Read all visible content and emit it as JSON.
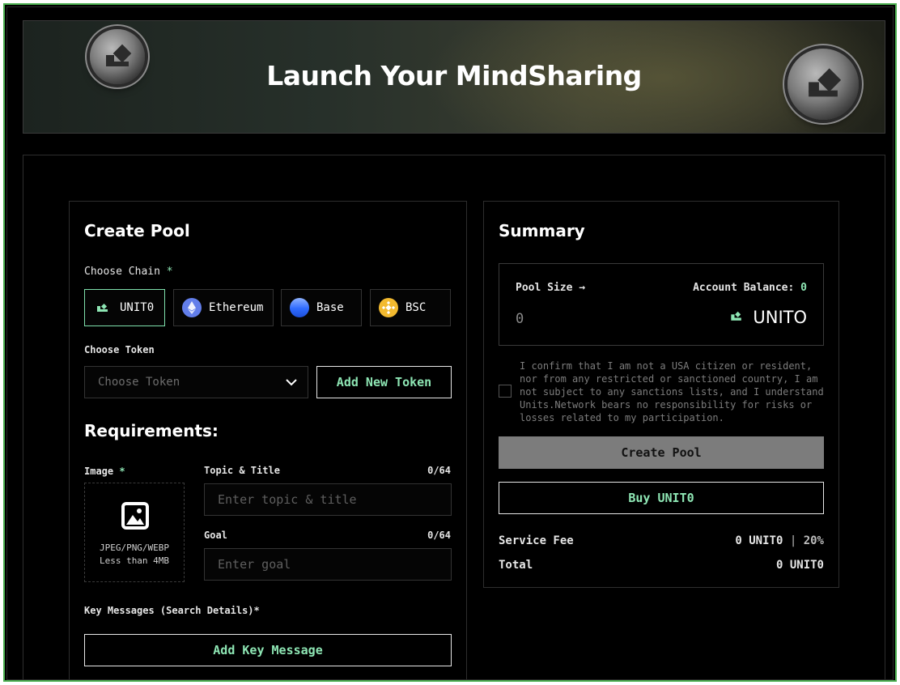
{
  "banner": {
    "title": "Launch Your MindSharing"
  },
  "create_pool": {
    "title": "Create Pool",
    "choose_chain_label": "Choose Chain",
    "required_mark": "*",
    "chains": [
      {
        "label": "UNIT0",
        "icon": "unit0-icon",
        "selected": true
      },
      {
        "label": "Ethereum",
        "icon": "ethereum-icon",
        "selected": false
      },
      {
        "label": "Base",
        "icon": "base-icon",
        "selected": false
      },
      {
        "label": "BSC",
        "icon": "bsc-icon",
        "selected": false
      }
    ],
    "choose_token_label": "Choose Token",
    "token_select_placeholder": "Choose Token",
    "add_new_token_label": "Add New Token",
    "requirements_title": "Requirements:",
    "image_label": "Image",
    "image_hint_formats": "JPEG/PNG/WEBP",
    "image_hint_size": "Less than 4MB",
    "topic_label": "Topic & Title",
    "topic_counter": "0/64",
    "topic_placeholder": "Enter topic & title",
    "goal_label": "Goal",
    "goal_counter": "0/64",
    "goal_placeholder": "Enter goal",
    "key_messages_label": "Key Messages (Search Details)*",
    "add_key_message_label": "Add Key Message"
  },
  "summary": {
    "title": "Summary",
    "pool_size_label": "Pool Size →",
    "account_balance_label": "Account Balance:",
    "account_balance_value": "0",
    "pool_size_value": "0",
    "token_name": "UNITO",
    "disclaimer": "I confirm that I am not a USA citizen or resident, nor from any restricted or sanctioned country, I am not subject to any sanctions lists, and I understand Units.Network bears no responsibility for risks or losses related to my participation.",
    "create_pool_button": "Create Pool",
    "buy_button": "Buy UNIT0",
    "service_fee_label": "Service Fee",
    "service_fee_value": "0 UNIT0",
    "service_fee_sep": "|",
    "service_fee_percent": "20%",
    "total_label": "Total",
    "total_value": "0 UNIT0"
  },
  "colors": {
    "accent": "#8ee6b4",
    "frame_border": "#4caf50",
    "ethereum": "#627eea",
    "base": "#2f6bff",
    "bsc": "#f3ba2f"
  }
}
